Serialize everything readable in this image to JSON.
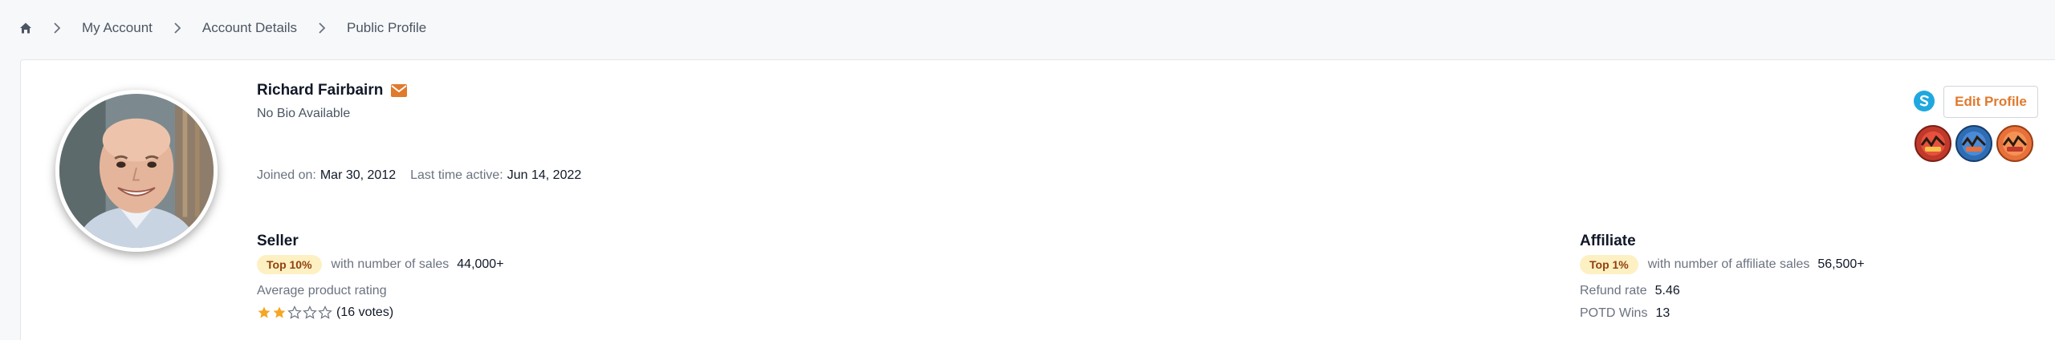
{
  "breadcrumb": {
    "home_icon": "home-icon",
    "items": [
      "My Account",
      "Account Details"
    ],
    "current": "Public Profile"
  },
  "profile": {
    "name": "Richard Fairbairn",
    "bio": "No Bio Available",
    "joined_label": "Joined on:",
    "joined_value": "Mar 30, 2012",
    "last_active_label": "Last time active:",
    "last_active_value": "Jun 14, 2022",
    "edit_label": "Edit Profile"
  },
  "seller": {
    "title": "Seller",
    "badge": "Top 10%",
    "sales_label": "with number of sales",
    "sales_value": "44,000+",
    "rating_label": "Average product rating",
    "rating": 2,
    "rating_max": 5,
    "votes": "(16 votes)"
  },
  "affiliate": {
    "title": "Affiliate",
    "badge": "Top 1%",
    "sales_label": "with number of affiliate sales",
    "sales_value": "56,500+",
    "refund_label": "Refund rate",
    "refund_value": "5.46",
    "potd_label": "POTD Wins",
    "potd_value": "13"
  },
  "colors": {
    "accent": "#e07a2d",
    "badge_bg": "#fdf0c2",
    "star": "#f5a623"
  }
}
